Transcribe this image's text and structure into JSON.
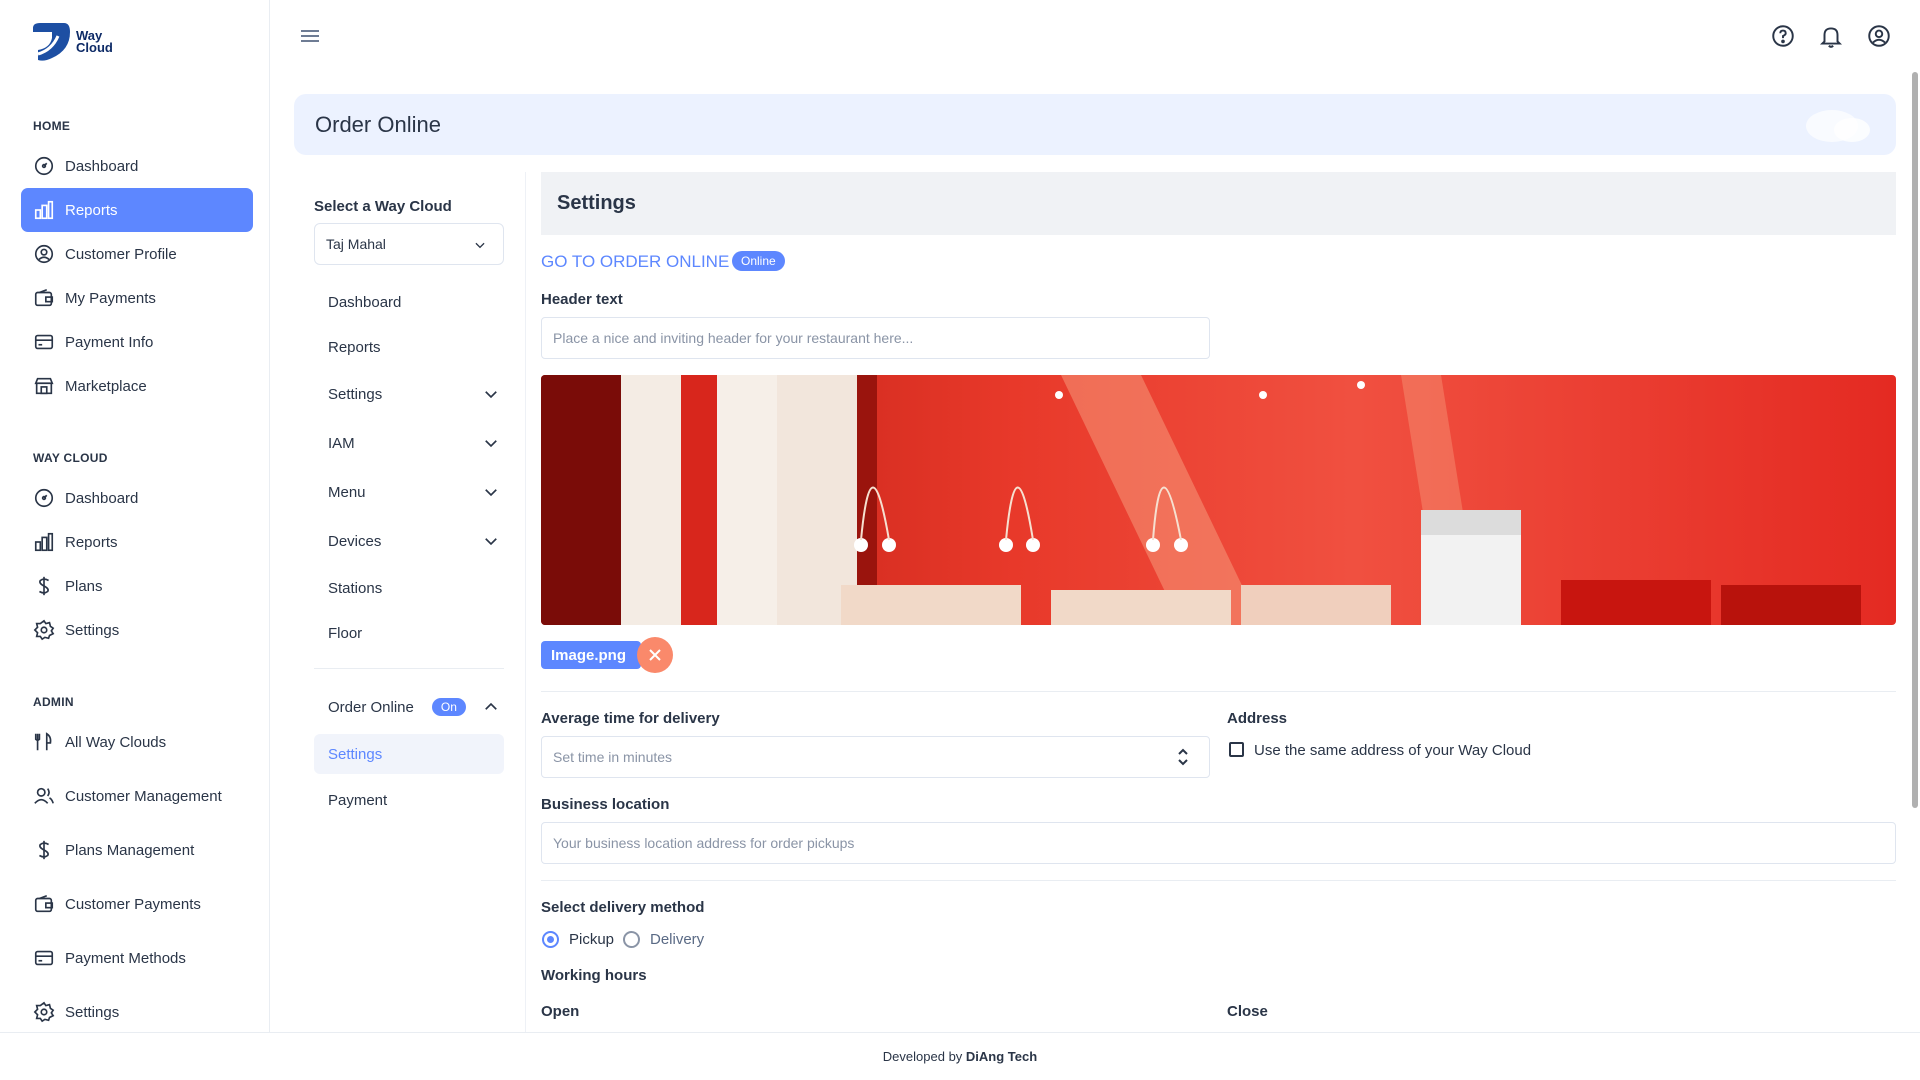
{
  "brand": {
    "name_line1": "Way",
    "name_line2": "Cloud"
  },
  "sidebar": {
    "sections": [
      {
        "title": "HOME"
      },
      {
        "title": "WAY CLOUD"
      },
      {
        "title": "ADMIN"
      }
    ],
    "home": [
      "Dashboard",
      "Reports",
      "Customer Profile",
      "My Payments",
      "Payment Info",
      "Marketplace"
    ],
    "waycloud": [
      "Dashboard",
      "Reports",
      "Plans",
      "Settings"
    ],
    "admin": [
      "All Way Clouds",
      "Customer Management",
      "Plans Management",
      "Customer Payments",
      "Payment Methods",
      "Settings"
    ],
    "active_item": "Reports"
  },
  "page": {
    "title": "Order Online"
  },
  "submenu": {
    "select_label": "Select a Way Cloud",
    "selected_cloud": "Taj Mahal",
    "items": [
      "Dashboard",
      "Reports",
      "Settings",
      "IAM",
      "Menu",
      "Devices",
      "Stations",
      "Floor"
    ],
    "order_online": {
      "label": "Order Online",
      "badge": "On",
      "children": [
        "Settings",
        "Payment"
      ]
    }
  },
  "settings": {
    "title": "Settings",
    "goto_link": "GO TO ORDER ONLINE",
    "status_badge": "Online",
    "header_text_label": "Header text",
    "header_text_placeholder": "Place a nice and inviting header for your restaurant here...",
    "image_file": "Image.png",
    "avg_delivery_label": "Average time for delivery",
    "avg_delivery_placeholder": "Set time in minutes",
    "address_label": "Address",
    "address_checkbox": "Use the same address of your Way Cloud",
    "business_location_label": "Business location",
    "business_location_placeholder": "Your business location address for order pickups",
    "delivery_method_label": "Select delivery method",
    "delivery_options": [
      "Pickup",
      "Delivery"
    ],
    "selected_delivery": "Pickup",
    "working_hours_label": "Working hours",
    "open_label": "Open",
    "close_label": "Close"
  },
  "footer": {
    "prefix": "Developed by",
    "company": "DiAng Tech"
  },
  "colors": {
    "accent": "#5d87ff",
    "header_bg": "#ecf2ff",
    "danger": "#fa896b",
    "text": "#2a3547"
  }
}
